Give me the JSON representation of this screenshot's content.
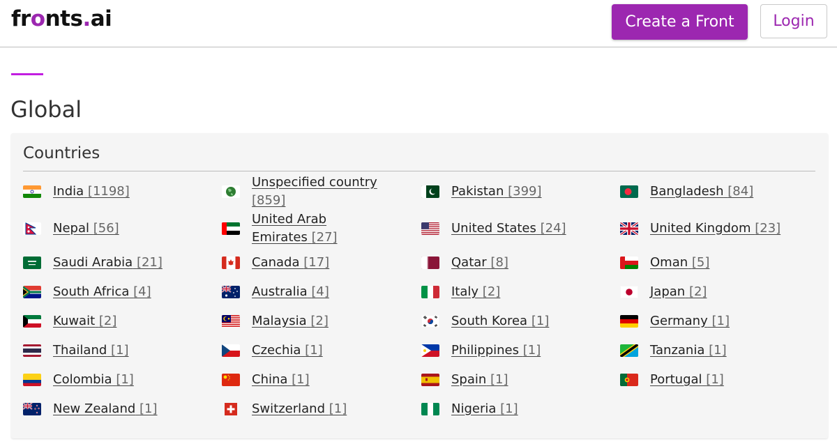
{
  "header": {
    "logo": {
      "part1": "fr",
      "part2": "o",
      "part3": "nts",
      "part4": ".",
      "part5": "ai"
    },
    "create_label": "Create a Front",
    "login_label": "Login"
  },
  "page": {
    "title": "Global"
  },
  "panel": {
    "title": "Countries"
  },
  "countries": [
    {
      "name": "India",
      "count": "[1198]",
      "flag": "india-flag-icon"
    },
    {
      "name": "Unspecified country",
      "count": "[859]",
      "flag": "globe-icon"
    },
    {
      "name": "Pakistan",
      "count": "[399]",
      "flag": "pakistan-flag-icon"
    },
    {
      "name": "Bangladesh",
      "count": "[84]",
      "flag": "bangladesh-flag-icon"
    },
    {
      "name": "Nepal",
      "count": "[56]",
      "flag": "nepal-flag-icon"
    },
    {
      "name": "United Arab Emirates",
      "count": "[27]",
      "flag": "uae-flag-icon"
    },
    {
      "name": "United States",
      "count": "[24]",
      "flag": "usa-flag-icon"
    },
    {
      "name": "United Kingdom",
      "count": "[23]",
      "flag": "uk-flag-icon"
    },
    {
      "name": "Saudi Arabia",
      "count": "[21]",
      "flag": "saudi-arabia-flag-icon"
    },
    {
      "name": "Canada",
      "count": "[17]",
      "flag": "canada-flag-icon"
    },
    {
      "name": "Qatar",
      "count": "[8]",
      "flag": "qatar-flag-icon"
    },
    {
      "name": "Oman",
      "count": "[5]",
      "flag": "oman-flag-icon"
    },
    {
      "name": "South Africa",
      "count": "[4]",
      "flag": "south-africa-flag-icon"
    },
    {
      "name": "Australia",
      "count": "[4]",
      "flag": "australia-flag-icon"
    },
    {
      "name": "Italy",
      "count": "[2]",
      "flag": "italy-flag-icon"
    },
    {
      "name": "Japan",
      "count": "[2]",
      "flag": "japan-flag-icon"
    },
    {
      "name": "Kuwait",
      "count": "[2]",
      "flag": "kuwait-flag-icon"
    },
    {
      "name": "Malaysia",
      "count": "[2]",
      "flag": "malaysia-flag-icon"
    },
    {
      "name": "South Korea",
      "count": "[1]",
      "flag": "south-korea-flag-icon"
    },
    {
      "name": "Germany",
      "count": "[1]",
      "flag": "germany-flag-icon"
    },
    {
      "name": "Thailand",
      "count": "[1]",
      "flag": "thailand-flag-icon"
    },
    {
      "name": "Czechia",
      "count": "[1]",
      "flag": "czechia-flag-icon"
    },
    {
      "name": "Philippines",
      "count": "[1]",
      "flag": "philippines-flag-icon"
    },
    {
      "name": "Tanzania",
      "count": "[1]",
      "flag": "tanzania-flag-icon"
    },
    {
      "name": "Colombia",
      "count": "[1]",
      "flag": "colombia-flag-icon"
    },
    {
      "name": "China",
      "count": "[1]",
      "flag": "china-flag-icon"
    },
    {
      "name": "Spain",
      "count": "[1]",
      "flag": "spain-flag-icon"
    },
    {
      "name": "Portugal",
      "count": "[1]",
      "flag": "portugal-flag-icon"
    },
    {
      "name": "New Zealand",
      "count": "[1]",
      "flag": "new-zealand-flag-icon"
    },
    {
      "name": "Switzerland",
      "count": "[1]",
      "flag": "switzerland-flag-icon"
    },
    {
      "name": "Nigeria",
      "count": "[1]",
      "flag": "nigeria-flag-icon"
    }
  ],
  "colors": {
    "brand": "#9c27b0",
    "accent": "#c21ee0"
  }
}
